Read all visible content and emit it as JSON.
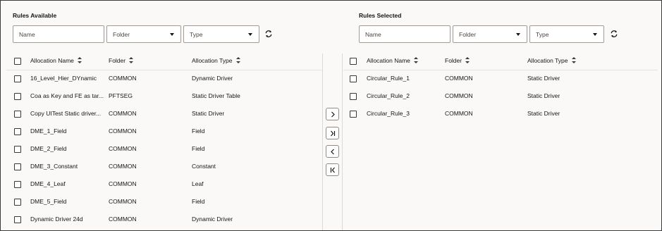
{
  "available": {
    "title": "Rules Available",
    "filters": {
      "name_placeholder": "Name",
      "folder_placeholder": "Folder",
      "type_placeholder": "Type"
    },
    "columns": [
      "Allocation Name",
      "Folder",
      "Allocation Type"
    ],
    "rows": [
      {
        "name": "16_Level_Hier_DYnamic",
        "folder": "COMMON",
        "type": "Dynamic Driver"
      },
      {
        "name": "Coa as Key and FE as tar...",
        "folder": "PFTSEG",
        "type": "Static Driver Table"
      },
      {
        "name": "Copy UITest Static driver...",
        "folder": "COMMON",
        "type": "Static Driver"
      },
      {
        "name": "DME_1_Field",
        "folder": "COMMON",
        "type": "Field"
      },
      {
        "name": "DME_2_Field",
        "folder": "COMMON",
        "type": "Field"
      },
      {
        "name": "DME_3_Constant",
        "folder": "COMMON",
        "type": "Constant"
      },
      {
        "name": "DME_4_Leaf",
        "folder": "COMMON",
        "type": "Leaf"
      },
      {
        "name": "DME_5_Field",
        "folder": "COMMON",
        "type": "Field"
      },
      {
        "name": "Dynamic Driver 24d",
        "folder": "COMMON",
        "type": "Dynamic Driver"
      }
    ]
  },
  "selected": {
    "title": "Rules Selected",
    "filters": {
      "name_placeholder": "Name",
      "folder_placeholder": "Folder",
      "type_placeholder": "Type"
    },
    "columns": [
      "Allocation Name",
      "Folder",
      "Allocation Type"
    ],
    "rows": [
      {
        "name": "Circular_Rule_1",
        "folder": "COMMON",
        "type": "Static Driver"
      },
      {
        "name": "Circular_Rule_2",
        "folder": "COMMON",
        "type": "Static Driver"
      },
      {
        "name": "Circular_Rule_3",
        "folder": "COMMON",
        "type": "Static Driver"
      }
    ]
  },
  "move_buttons": [
    {
      "name": "move-right-button",
      "icon": "chevron-right-icon"
    },
    {
      "name": "move-all-right-button",
      "icon": "move-all-right-icon"
    },
    {
      "name": "move-left-button",
      "icon": "chevron-left-icon"
    },
    {
      "name": "move-all-left-button",
      "icon": "move-all-left-icon"
    }
  ],
  "colors": {
    "background": "#fbf9f8",
    "border": "#9f9c98",
    "text": "#161513"
  }
}
